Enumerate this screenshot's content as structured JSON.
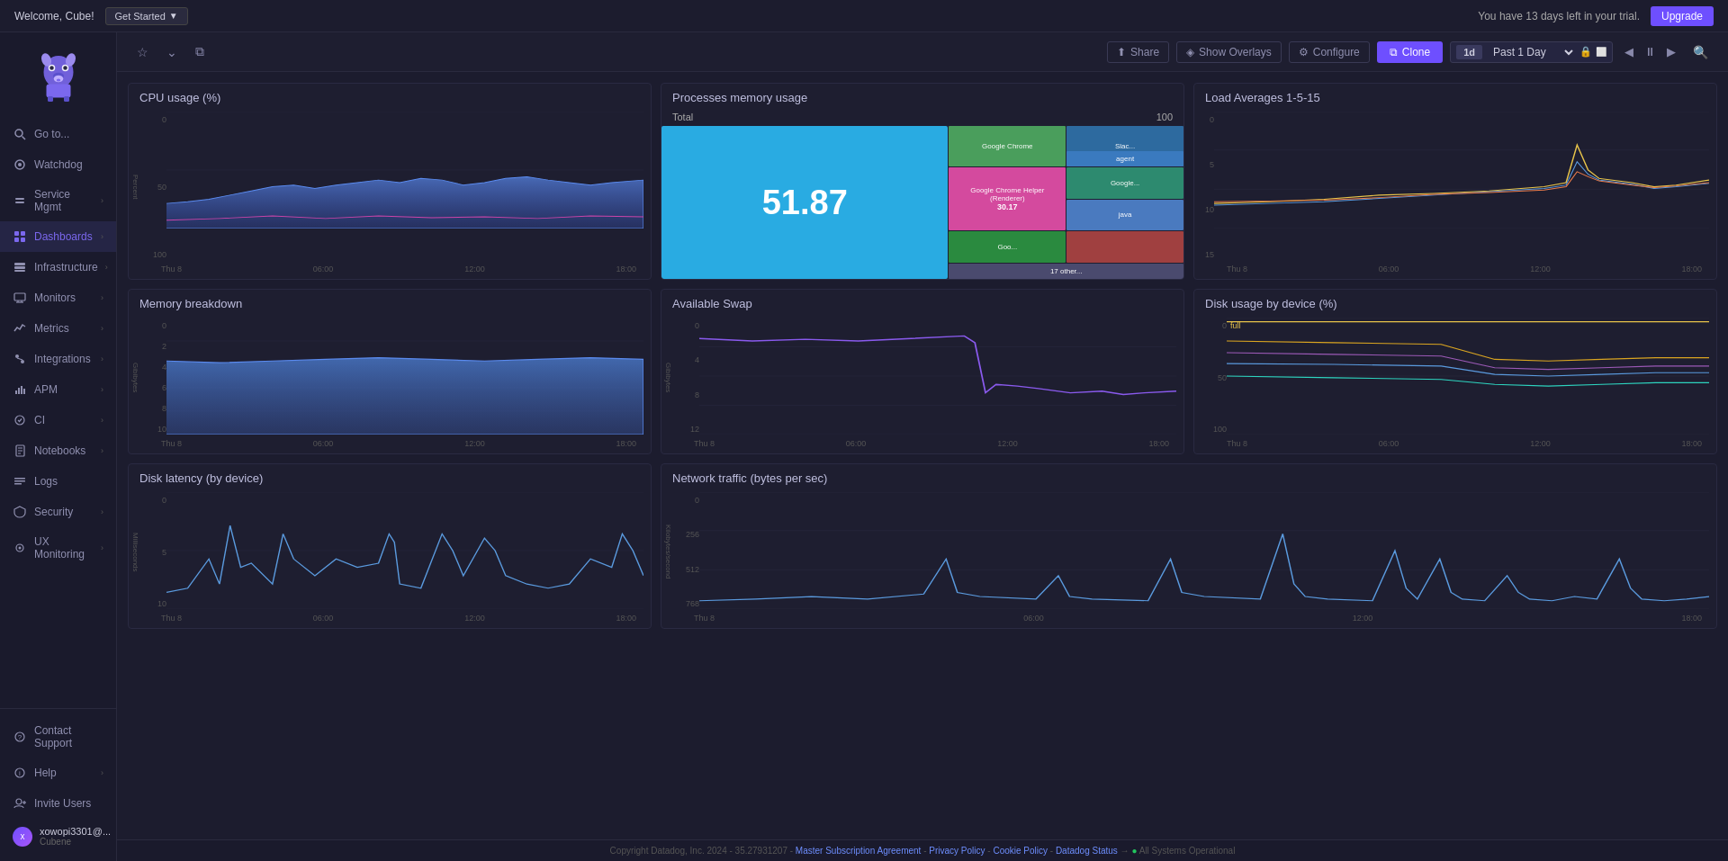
{
  "topbar": {
    "welcome": "Welcome, Cube!",
    "get_started": "Get Started",
    "trial_text": "You have 13 days left in your trial.",
    "upgrade_label": "Upgrade"
  },
  "sidebar": {
    "logo_alt": "Datadog",
    "items": [
      {
        "id": "go-to",
        "label": "Go to...",
        "has_arrow": false
      },
      {
        "id": "watchdog",
        "label": "Watchdog",
        "has_arrow": false
      },
      {
        "id": "service-mgmt",
        "label": "Service Mgmt",
        "has_arrow": true
      },
      {
        "id": "dashboards",
        "label": "Dashboards",
        "has_arrow": true,
        "active": true
      },
      {
        "id": "infrastructure",
        "label": "Infrastructure",
        "has_arrow": true
      },
      {
        "id": "monitors",
        "label": "Monitors",
        "has_arrow": true
      },
      {
        "id": "metrics",
        "label": "Metrics",
        "has_arrow": true
      },
      {
        "id": "integrations",
        "label": "Integrations",
        "has_arrow": true
      },
      {
        "id": "apm",
        "label": "APM",
        "has_arrow": true
      },
      {
        "id": "ci",
        "label": "CI",
        "has_arrow": true
      },
      {
        "id": "notebooks",
        "label": "Notebooks",
        "has_arrow": true
      },
      {
        "id": "logs",
        "label": "Logs",
        "has_arrow": false
      },
      {
        "id": "security",
        "label": "Security",
        "has_arrow": true
      },
      {
        "id": "ux-monitoring",
        "label": "UX Monitoring",
        "has_arrow": true
      }
    ],
    "bottom_items": [
      {
        "id": "contact-support",
        "label": "Contact Support"
      },
      {
        "id": "help",
        "label": "Help"
      },
      {
        "id": "invite-users",
        "label": "Invite Users"
      }
    ],
    "user": {
      "name": "xowopi3301@...",
      "org": "Cubene"
    }
  },
  "toolbar": {
    "star_label": "☆",
    "nav_down": "⌄",
    "copy_label": "⧉",
    "share_label": "Share",
    "show_overlays_label": "Show Overlays",
    "configure_label": "Configure",
    "clone_label": "Clone",
    "time_1d": "1d",
    "time_range": "Past 1 Day"
  },
  "widgets": {
    "cpu_usage": {
      "title": "CPU usage (%)",
      "y_labels": [
        "100",
        "50",
        "0"
      ],
      "x_labels": [
        "Thu 8",
        "06:00",
        "12:00",
        "18:00"
      ]
    },
    "processes_memory": {
      "title": "Processes memory usage",
      "total_label": "Total",
      "total_value": "100",
      "main_value": "51.87",
      "cells": [
        {
          "label": "Google Chrome",
          "color": "#4a9e5c",
          "size": "large"
        },
        {
          "label": "Slac...",
          "color": "#2d6a9f",
          "size": "medium"
        },
        {
          "label": "agent",
          "color": "#3a7abf",
          "size": "medium"
        },
        {
          "label": "Google Chrome Helper (Renderer)",
          "color": "#d44a9e",
          "size": "large",
          "value": "30.17"
        },
        {
          "label": "Google...",
          "color": "#2d8a6f",
          "size": "small"
        },
        {
          "label": "java",
          "color": "#4a7abf",
          "size": "small"
        },
        {
          "label": "Goo...",
          "color": "#2a8a3f",
          "size": "small"
        },
        {
          "label": "",
          "color": "#a04040",
          "size": "small"
        },
        {
          "label": "17 other...",
          "color": "#4a4a6e",
          "size": "medium"
        }
      ]
    },
    "load_averages": {
      "title": "Load Averages 1-5-15",
      "y_labels": [
        "15",
        "10",
        "5",
        "0"
      ],
      "x_labels": [
        "Thu 8",
        "06:00",
        "12:00",
        "18:00"
      ]
    },
    "memory_breakdown": {
      "title": "Memory breakdown",
      "y_labels": [
        "10",
        "8",
        "6",
        "4",
        "2",
        "0"
      ],
      "y_axis_label": "Gibibytes",
      "x_labels": [
        "Thu 8",
        "06:00",
        "12:00",
        "18:00"
      ]
    },
    "available_swap": {
      "title": "Available Swap",
      "y_labels": [
        "12",
        "8",
        "4",
        "0"
      ],
      "y_axis_label": "Gibibytes",
      "x_labels": [
        "Thu 8",
        "06:00",
        "12:00",
        "18:00"
      ]
    },
    "disk_usage": {
      "title": "Disk usage by device (%)",
      "y_labels": [
        "100",
        "50",
        "0"
      ],
      "x_labels": [
        "Thu 8",
        "06:00",
        "12:00",
        "18:00"
      ],
      "legend": "full"
    },
    "disk_latency": {
      "title": "Disk latency (by device)",
      "y_labels": [
        "10",
        "5",
        "0"
      ],
      "y_axis_label": "Milliseconds",
      "x_labels": [
        "Thu 8",
        "06:00",
        "12:00",
        "18:00"
      ]
    },
    "network_traffic": {
      "title": "Network traffic (bytes per sec)",
      "y_labels": [
        "768",
        "512",
        "256",
        "0"
      ],
      "y_axis_label": "Kilobytes/second",
      "x_labels": [
        "Thu 8",
        "06:00",
        "12:00",
        "18:00"
      ]
    }
  },
  "footer": {
    "copyright": "Copyright Datadog, Inc. 2024 - 35.27931207 -",
    "links": [
      "Master Subscription Agreement",
      "Privacy Policy",
      "Cookie Policy",
      "Datadog Status"
    ],
    "status": "All Systems Operational"
  }
}
